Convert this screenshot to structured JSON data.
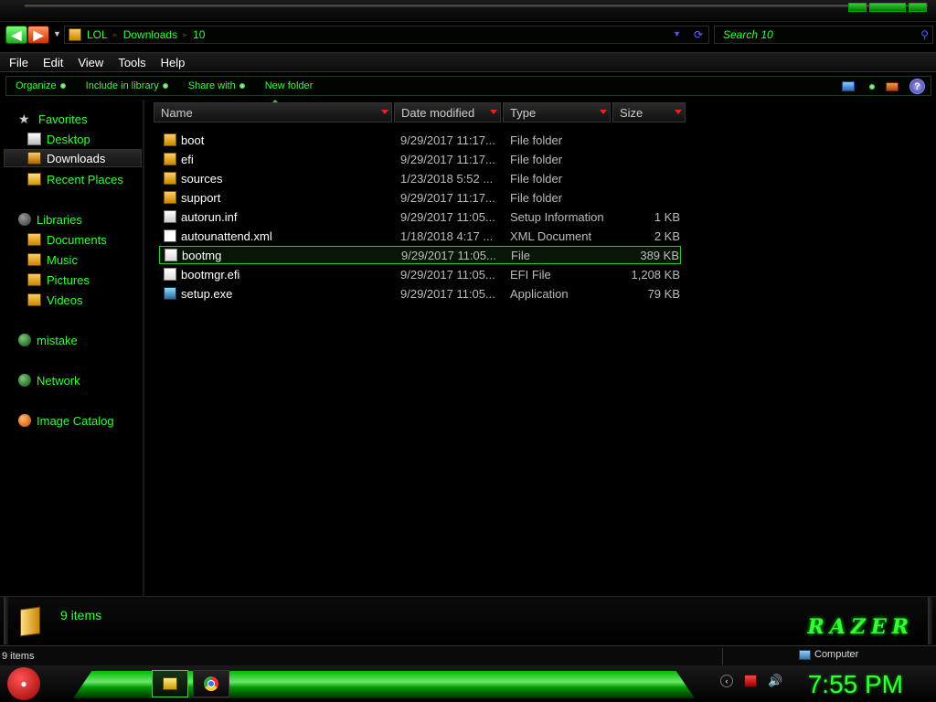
{
  "nav": {
    "breadcrumbs": [
      "LOL",
      "Downloads",
      "10"
    ],
    "search_placeholder": "Search 10"
  },
  "menu": [
    "File",
    "Edit",
    "View",
    "Tools",
    "Help"
  ],
  "commands": [
    "Organize",
    "Include in library",
    "Share with",
    "New folder"
  ],
  "sidebar": {
    "favorites": "Favorites",
    "desktop": "Desktop",
    "downloads": "Downloads",
    "recent_places": "Recent Places",
    "libraries": "Libraries",
    "documents": "Documents",
    "music": "Music",
    "pictures": "Pictures",
    "videos": "Videos",
    "mistake": "mistake",
    "network": "Network",
    "image_catalog": "Image Catalog"
  },
  "columns": {
    "name": "Name",
    "date": "Date modified",
    "type": "Type",
    "size": "Size"
  },
  "files": [
    {
      "name": "boot",
      "date": "9/29/2017 11:17...",
      "type": "File folder",
      "size": "",
      "icon": "folder-icon"
    },
    {
      "name": "efi",
      "date": "9/29/2017 11:17...",
      "type": "File folder",
      "size": "",
      "icon": "folder-icon"
    },
    {
      "name": "sources",
      "date": "1/23/2018 5:52 ...",
      "type": "File folder",
      "size": "",
      "icon": "folder-icon"
    },
    {
      "name": "support",
      "date": "9/29/2017 11:17...",
      "type": "File folder",
      "size": "",
      "icon": "folder-icon"
    },
    {
      "name": "autorun.inf",
      "date": "9/29/2017 11:05...",
      "type": "Setup Information",
      "size": "1 KB",
      "icon": "setup-info-icon"
    },
    {
      "name": "autounattend.xml",
      "date": "1/18/2018 4:17 ...",
      "type": "XML Document",
      "size": "2 KB",
      "icon": "xml-icon"
    },
    {
      "name": "bootmg",
      "date": "9/29/2017 11:05...",
      "type": "File",
      "size": "389 KB",
      "icon": "file-icon"
    },
    {
      "name": "bootmgr.efi",
      "date": "9/29/2017 11:05...",
      "type": "EFI File",
      "size": "1,208 KB",
      "icon": "file-icon"
    },
    {
      "name": "setup.exe",
      "date": "9/29/2017 11:05...",
      "type": "Application",
      "size": "79 KB",
      "icon": "app-icon"
    }
  ],
  "selected_row": 6,
  "details": {
    "item_count": "9 items",
    "brand": "RAZER"
  },
  "status": {
    "left": "9 items",
    "right": "Computer"
  },
  "taskbar": {
    "clock": "7:55 PM"
  },
  "colors": {
    "accent_green": "#33ff33",
    "background": "#000000",
    "header_arrow_red": "#ee2222"
  }
}
